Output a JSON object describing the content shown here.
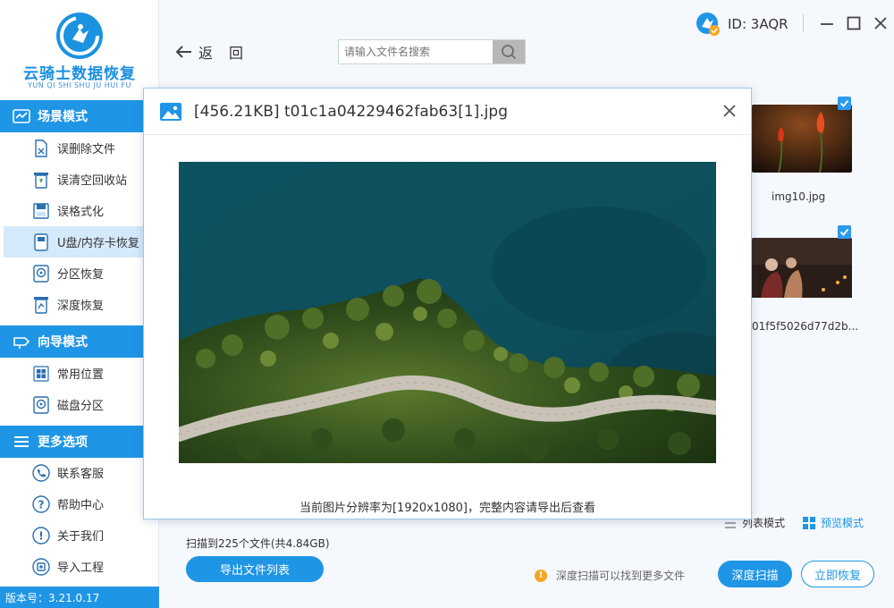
{
  "app": {
    "logo_title": "云骑士数据恢复",
    "logo_subtitle": "YUN QI SHI SHU JU HUI FU",
    "version": "版本号：3.21.0.17",
    "brand_color": "#1f95e6"
  },
  "sidebar": {
    "scene_header": "场景模式",
    "scene_items": [
      {
        "label": "误删除文件",
        "icon": "file-delete-icon"
      },
      {
        "label": "误清空回收站",
        "icon": "recycle-bin-icon"
      },
      {
        "label": "误格式化",
        "icon": "format-disk-icon"
      },
      {
        "label": "U盘/内存卡恢复",
        "icon": "usb-card-icon"
      },
      {
        "label": "分区恢复",
        "icon": "partition-icon"
      },
      {
        "label": "深度恢复",
        "icon": "deep-recover-icon"
      }
    ],
    "guide_header": "向导模式",
    "guide_items": [
      {
        "label": "常用位置",
        "icon": "windows-icon"
      },
      {
        "label": "磁盘分区",
        "icon": "disk-icon"
      }
    ],
    "more_header": "更多选项",
    "more_items": [
      {
        "label": "联系客服",
        "icon": "phone-icon"
      },
      {
        "label": "帮助中心",
        "icon": "help-icon"
      },
      {
        "label": "关于我们",
        "icon": "info-icon"
      },
      {
        "label": "导入工程",
        "icon": "import-icon"
      }
    ],
    "active_item": "U盘/内存卡恢复"
  },
  "toolbar": {
    "back_label": "返回",
    "search_placeholder": "请输入文件名搜索"
  },
  "user": {
    "id_label": "ID: 3AQR"
  },
  "files": [
    {
      "name": "img10.jpg",
      "checked": true
    },
    {
      "name": "01f5f5026d77d2b...",
      "checked": true
    }
  ],
  "view_modes": {
    "list": "列表模式",
    "preview": "预览模式"
  },
  "footer": {
    "scan_info": "扫描到225个文件(共4.84GB)",
    "export_label": "导出文件列表",
    "hint": "深度扫描可以找到更多文件",
    "deep_scan_label": "深度扫描",
    "recover_label": "立即恢复"
  },
  "preview_dialog": {
    "title": "[456.21KB] t01c1a04229462fab63[1].jpg",
    "caption": "当前图片分辨率为[1920x1080]，完整内容请导出后查看"
  }
}
